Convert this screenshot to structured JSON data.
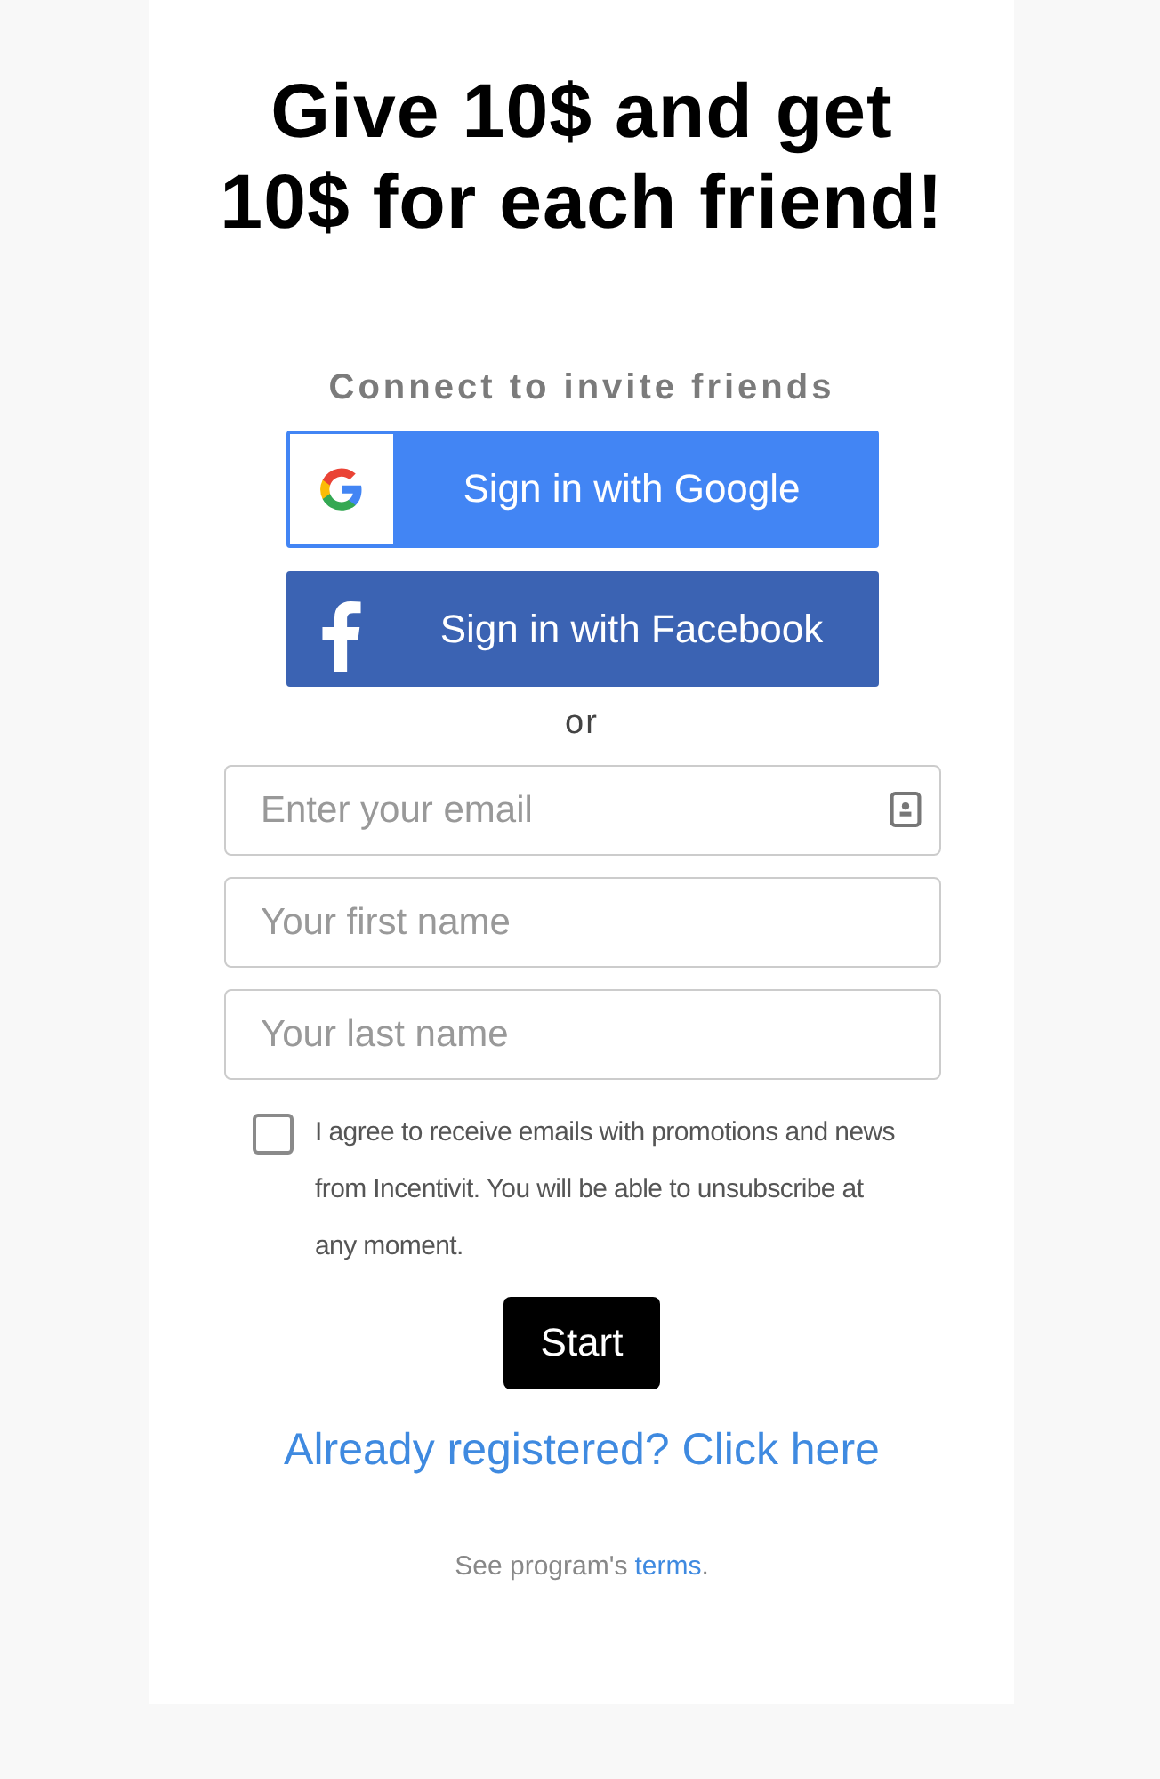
{
  "headline": "Give 10$ and get 10$ for each friend!",
  "subtitle": "Connect to invite friends",
  "social_buttons": [
    {
      "kind": "google",
      "label": "Sign in with Google"
    },
    {
      "kind": "facebook",
      "label": "Sign in with Facebook"
    }
  ],
  "separator": "or",
  "fields": [
    {
      "placeholder": "Enter your email",
      "contact_icon": true
    },
    {
      "placeholder": "Your first name",
      "contact_icon": false
    },
    {
      "placeholder": "Your last name",
      "contact_icon": false
    }
  ],
  "consent": {
    "checked": false,
    "text": "I agree to receive emails with promotions and news from Incentivit. You will be able to unsubscribe at any moment."
  },
  "start_button": "Start",
  "login_link": "Already registered? Click here",
  "footer": {
    "text": "See program's",
    "link": "terms",
    "end": "."
  }
}
